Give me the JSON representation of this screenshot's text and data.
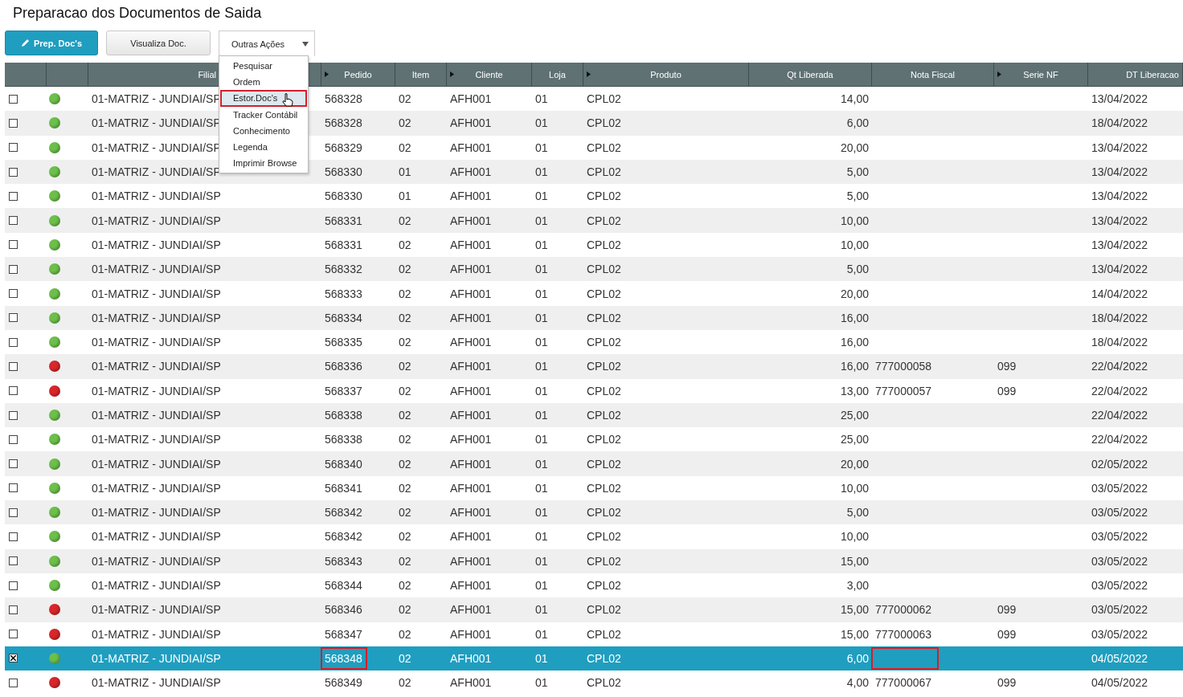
{
  "title": "Preparacao dos Documentos de Saida",
  "buttons": [
    {
      "label": "Prep. Doc's",
      "kind": "primary"
    },
    {
      "label": "Visualiza Doc.",
      "kind": "plain"
    }
  ],
  "actions_menu": {
    "label": "Outras Ações",
    "expanded": true,
    "items": [
      {
        "label": "Pesquisar",
        "highlighted": false
      },
      {
        "label": "Ordem",
        "highlighted": false
      },
      {
        "label": "Estor.Doc's",
        "highlighted": true
      },
      {
        "label": "Tracker Contábil",
        "highlighted": false
      },
      {
        "label": "Conhecimento",
        "highlighted": false
      },
      {
        "label": "Legenda",
        "highlighted": false
      },
      {
        "label": "Imprimir Browse",
        "highlighted": false
      }
    ]
  },
  "table": {
    "columns": [
      {
        "label": "Filial",
        "marker": false
      },
      {
        "label": "Pedido",
        "marker": true
      },
      {
        "label": "Item",
        "marker": false
      },
      {
        "label": "Cliente",
        "marker": true
      },
      {
        "label": "Loja",
        "marker": false
      },
      {
        "label": "Produto",
        "marker": true
      },
      {
        "label": "Qt Liberada",
        "marker": false
      },
      {
        "label": "Nota Fiscal",
        "marker": false
      },
      {
        "label": "Serie NF",
        "marker": true
      },
      {
        "label": "DT Liberacao",
        "marker": false
      }
    ],
    "rows": [
      {
        "selected": false,
        "color": "#6cc04a",
        "filial": "01-MATRIZ - JUNDIAI/SP",
        "pedido": "568328",
        "item": "02",
        "cliente": "AFH001",
        "loja": "01",
        "produto": "CPL02",
        "qt": "14,00",
        "dt": "13/04/2022",
        "pedido_framed": false,
        "nota_framed": false
      },
      {
        "selected": false,
        "color": "#6cc04a",
        "filial": "01-MATRIZ - JUNDIAI/SP",
        "pedido": "568328",
        "item": "02",
        "cliente": "AFH001",
        "loja": "01",
        "produto": "CPL02",
        "qt": "6,00",
        "dt": "18/04/2022",
        "pedido_framed": false,
        "nota_framed": false
      },
      {
        "selected": false,
        "color": "#6cc04a",
        "filial": "01-MATRIZ - JUNDIAI/SP",
        "pedido": "568329",
        "item": "02",
        "cliente": "AFH001",
        "loja": "01",
        "produto": "CPL02",
        "qt": "20,00",
        "dt": "13/04/2022",
        "pedido_framed": false,
        "nota_framed": false
      },
      {
        "selected": false,
        "color": "#6cc04a",
        "filial": "01-MATRIZ - JUNDIAI/SP",
        "pedido": "568330",
        "item": "01",
        "cliente": "AFH001",
        "loja": "01",
        "produto": "CPL02",
        "qt": "5,00",
        "dt": "13/04/2022",
        "pedido_framed": false,
        "nota_framed": false
      },
      {
        "selected": false,
        "color": "#6cc04a",
        "filial": "01-MATRIZ - JUNDIAI/SP",
        "pedido": "568330",
        "item": "01",
        "cliente": "AFH001",
        "loja": "01",
        "produto": "CPL02",
        "qt": "5,00",
        "dt": "13/04/2022",
        "pedido_framed": false,
        "nota_framed": false
      },
      {
        "selected": false,
        "color": "#6cc04a",
        "filial": "01-MATRIZ - JUNDIAI/SP",
        "pedido": "568331",
        "item": "02",
        "cliente": "AFH001",
        "loja": "01",
        "produto": "CPL02",
        "qt": "10,00",
        "dt": "13/04/2022",
        "pedido_framed": false,
        "nota_framed": false
      },
      {
        "selected": false,
        "color": "#6cc04a",
        "filial": "01-MATRIZ - JUNDIAI/SP",
        "pedido": "568331",
        "item": "02",
        "cliente": "AFH001",
        "loja": "01",
        "produto": "CPL02",
        "qt": "10,00",
        "dt": "13/04/2022",
        "pedido_framed": false,
        "nota_framed": false
      },
      {
        "selected": false,
        "color": "#6cc04a",
        "filial": "01-MATRIZ - JUNDIAI/SP",
        "pedido": "568332",
        "item": "02",
        "cliente": "AFH001",
        "loja": "01",
        "produto": "CPL02",
        "qt": "5,00",
        "dt": "13/04/2022",
        "pedido_framed": false,
        "nota_framed": false
      },
      {
        "selected": false,
        "color": "#6cc04a",
        "filial": "01-MATRIZ - JUNDIAI/SP",
        "pedido": "568333",
        "item": "02",
        "cliente": "AFH001",
        "loja": "01",
        "produto": "CPL02",
        "qt": "20,00",
        "dt": "14/04/2022",
        "pedido_framed": false,
        "nota_framed": false
      },
      {
        "selected": false,
        "color": "#6cc04a",
        "filial": "01-MATRIZ - JUNDIAI/SP",
        "pedido": "568334",
        "item": "02",
        "cliente": "AFH001",
        "loja": "01",
        "produto": "CPL02",
        "qt": "16,00",
        "dt": "18/04/2022",
        "pedido_framed": false,
        "nota_framed": false
      },
      {
        "selected": false,
        "color": "#6cc04a",
        "filial": "01-MATRIZ - JUNDIAI/SP",
        "pedido": "568335",
        "item": "02",
        "cliente": "AFH001",
        "loja": "01",
        "produto": "CPL02",
        "qt": "16,00",
        "dt": "18/04/2022",
        "pedido_framed": false,
        "nota_framed": false
      },
      {
        "selected": false,
        "color": "#d9262b",
        "filial": "01-MATRIZ - JUNDIAI/SP",
        "pedido": "568336",
        "item": "02",
        "cliente": "AFH001",
        "loja": "01",
        "produto": "CPL02",
        "qt": "16,00",
        "nota_fiscal": "777000058",
        "serie": "099",
        "dt": "22/04/2022",
        "pedido_framed": false,
        "nota_framed": false
      },
      {
        "selected": false,
        "color": "#d9262b",
        "filial": "01-MATRIZ - JUNDIAI/SP",
        "pedido": "568337",
        "item": "02",
        "cliente": "AFH001",
        "loja": "01",
        "produto": "CPL02",
        "qt": "13,00",
        "nota_fiscal": "777000057",
        "serie": "099",
        "dt": "22/04/2022",
        "pedido_framed": false,
        "nota_framed": false
      },
      {
        "selected": false,
        "color": "#6cc04a",
        "filial": "01-MATRIZ - JUNDIAI/SP",
        "pedido": "568338",
        "item": "02",
        "cliente": "AFH001",
        "loja": "01",
        "produto": "CPL02",
        "qt": "25,00",
        "dt": "22/04/2022",
        "pedido_framed": false,
        "nota_framed": false
      },
      {
        "selected": false,
        "color": "#6cc04a",
        "filial": "01-MATRIZ - JUNDIAI/SP",
        "pedido": "568338",
        "item": "02",
        "cliente": "AFH001",
        "loja": "01",
        "produto": "CPL02",
        "qt": "25,00",
        "dt": "22/04/2022",
        "pedido_framed": false,
        "nota_framed": false
      },
      {
        "selected": false,
        "color": "#6cc04a",
        "filial": "01-MATRIZ - JUNDIAI/SP",
        "pedido": "568340",
        "item": "02",
        "cliente": "AFH001",
        "loja": "01",
        "produto": "CPL02",
        "qt": "20,00",
        "dt": "02/05/2022",
        "pedido_framed": false,
        "nota_framed": false
      },
      {
        "selected": false,
        "color": "#6cc04a",
        "filial": "01-MATRIZ - JUNDIAI/SP",
        "pedido": "568341",
        "item": "02",
        "cliente": "AFH001",
        "loja": "01",
        "produto": "CPL02",
        "qt": "10,00",
        "dt": "03/05/2022",
        "pedido_framed": false,
        "nota_framed": false
      },
      {
        "selected": false,
        "color": "#6cc04a",
        "filial": "01-MATRIZ - JUNDIAI/SP",
        "pedido": "568342",
        "item": "02",
        "cliente": "AFH001",
        "loja": "01",
        "produto": "CPL02",
        "qt": "5,00",
        "dt": "03/05/2022",
        "pedido_framed": false,
        "nota_framed": false
      },
      {
        "selected": false,
        "color": "#6cc04a",
        "filial": "01-MATRIZ - JUNDIAI/SP",
        "pedido": "568342",
        "item": "02",
        "cliente": "AFH001",
        "loja": "01",
        "produto": "CPL02",
        "qt": "10,00",
        "dt": "03/05/2022",
        "pedido_framed": false,
        "nota_framed": false
      },
      {
        "selected": false,
        "color": "#6cc04a",
        "filial": "01-MATRIZ - JUNDIAI/SP",
        "pedido": "568343",
        "item": "02",
        "cliente": "AFH001",
        "loja": "01",
        "produto": "CPL02",
        "qt": "15,00",
        "dt": "03/05/2022",
        "pedido_framed": false,
        "nota_framed": false
      },
      {
        "selected": false,
        "color": "#6cc04a",
        "filial": "01-MATRIZ - JUNDIAI/SP",
        "pedido": "568344",
        "item": "02",
        "cliente": "AFH001",
        "loja": "01",
        "produto": "CPL02",
        "qt": "3,00",
        "dt": "03/05/2022",
        "pedido_framed": false,
        "nota_framed": false
      },
      {
        "selected": false,
        "color": "#d9262b",
        "filial": "01-MATRIZ - JUNDIAI/SP",
        "pedido": "568346",
        "item": "02",
        "cliente": "AFH001",
        "loja": "01",
        "produto": "CPL02",
        "qt": "15,00",
        "nota_fiscal": "777000062",
        "serie": "099",
        "dt": "03/05/2022",
        "pedido_framed": false,
        "nota_framed": false
      },
      {
        "selected": false,
        "color": "#d9262b",
        "filial": "01-MATRIZ - JUNDIAI/SP",
        "pedido": "568347",
        "item": "02",
        "cliente": "AFH001",
        "loja": "01",
        "produto": "CPL02",
        "qt": "15,00",
        "nota_fiscal": "777000063",
        "serie": "099",
        "dt": "03/05/2022",
        "pedido_framed": false,
        "nota_framed": false
      },
      {
        "selected": true,
        "color": "#6cc04a",
        "filial": "01-MATRIZ - JUNDIAI/SP",
        "pedido": "568348",
        "item": "02",
        "cliente": "AFH001",
        "loja": "01",
        "produto": "CPL02",
        "qt": "6,00",
        "dt": "04/05/2022",
        "pedido_framed": true,
        "nota_framed": true
      },
      {
        "selected": false,
        "color": "#d9262b",
        "filial": "01-MATRIZ - JUNDIAI/SP",
        "pedido": "568349",
        "item": "02",
        "cliente": "AFH001",
        "loja": "01",
        "produto": "CPL02",
        "qt": "4,00",
        "nota_fiscal": "777000067",
        "serie": "099",
        "dt": "04/05/2022",
        "pedido_framed": false,
        "nota_framed": false
      }
    ]
  }
}
